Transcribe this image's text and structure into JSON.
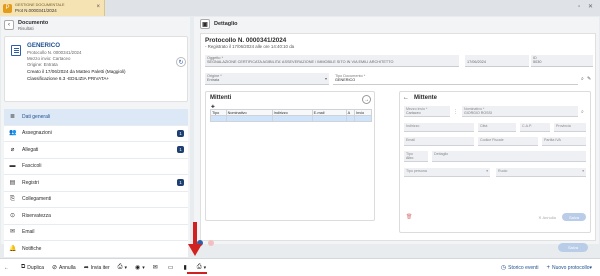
{
  "app_tab": {
    "line1": "GESTIONE DOCUMENTALE",
    "line2": "Prot N.0000341/2024",
    "logo": "P",
    "close": "×"
  },
  "window_controls": "▫ ✕",
  "left": {
    "header_title": "Documento",
    "header_sub": "Risultati",
    "back": "‹",
    "doc": {
      "title": "GENERICO",
      "lines": [
        "Protocollo N. 0000341/2024",
        "Mezzo invio: Cartaceo",
        "Origine: Entrata"
      ],
      "created": "Creato il 17/06/2024 da Matteo Paletti (Maggioli)",
      "class": "Classificazione 6.3 -EDILIZIA PRIVATA+",
      "refresh": "↻"
    },
    "nav": [
      {
        "label": "Dati generali",
        "icon": "≣",
        "badge": ""
      },
      {
        "label": "Assegnazioni",
        "icon": "👥",
        "badge": "1"
      },
      {
        "label": "Allegati",
        "icon": "⌀",
        "badge": "1"
      },
      {
        "label": "Fascicoli",
        "icon": "▬",
        "badge": ""
      },
      {
        "label": "Registri",
        "icon": "▤",
        "badge": "1"
      },
      {
        "label": "Collegamenti",
        "icon": "⎘",
        "badge": ""
      },
      {
        "label": "Riservatezza",
        "icon": "⊙",
        "badge": ""
      },
      {
        "label": "Email",
        "icon": "✉",
        "badge": ""
      },
      {
        "label": "Notifiche",
        "icon": "🔔",
        "badge": ""
      }
    ]
  },
  "right": {
    "header": "Dettaglio",
    "title": "Protocollo N. 0000341/2024",
    "subtitle": "- Registrato il 17/06/2024 alle ore 14:40:10 da",
    "oggetto_label": "Oggetto *",
    "oggetto_value": "SEGNALAZIONE CERTIFICATA AGIBILITA' ASSEVERAZIONE / IMMOBILE SITO IN VIA EMILI ARCHITETTO",
    "data_value": "17/06/2024",
    "id_label": "ID",
    "id_value": "5030",
    "origine_label": "Origine *",
    "origine_value": "Entrata",
    "tipo_label": "Tipo Documento *",
    "tipo_value": "GENERICO",
    "mittenti": {
      "title": "Mittenti",
      "arrow": "→",
      "columns": [
        "Tipo",
        "Nominativo",
        "Indirizzo",
        "E-mail",
        "A",
        "Invio"
      ],
      "toolbar": "✚"
    },
    "mittente": {
      "title": "Mittente",
      "back": "←",
      "mezzo_label": "Mezzo invio *",
      "mezzo_value": "Cartaceo",
      "nominativo_label": "Nominativo *",
      "nominativo_value": "GIORGIO ROSSI",
      "fields": [
        "Indirizzo",
        "Città",
        "C.A.P.",
        "Provincia",
        "Email",
        "Codice Fiscale",
        "Partita IVA",
        "Tipo",
        "Dettaglio",
        "Tipo persona",
        "Ruolo"
      ],
      "tipo_value": "Altro",
      "trash": "🗑",
      "annulla": "✕ Annulla",
      "salva": "Salva"
    },
    "save": "Salva"
  },
  "bottom": {
    "items": [
      "Duplica",
      "Annulla",
      "Invia iter"
    ],
    "right_items": [
      "Storico eventi",
      "Nuovo protocollo"
    ],
    "caret": "▾"
  }
}
